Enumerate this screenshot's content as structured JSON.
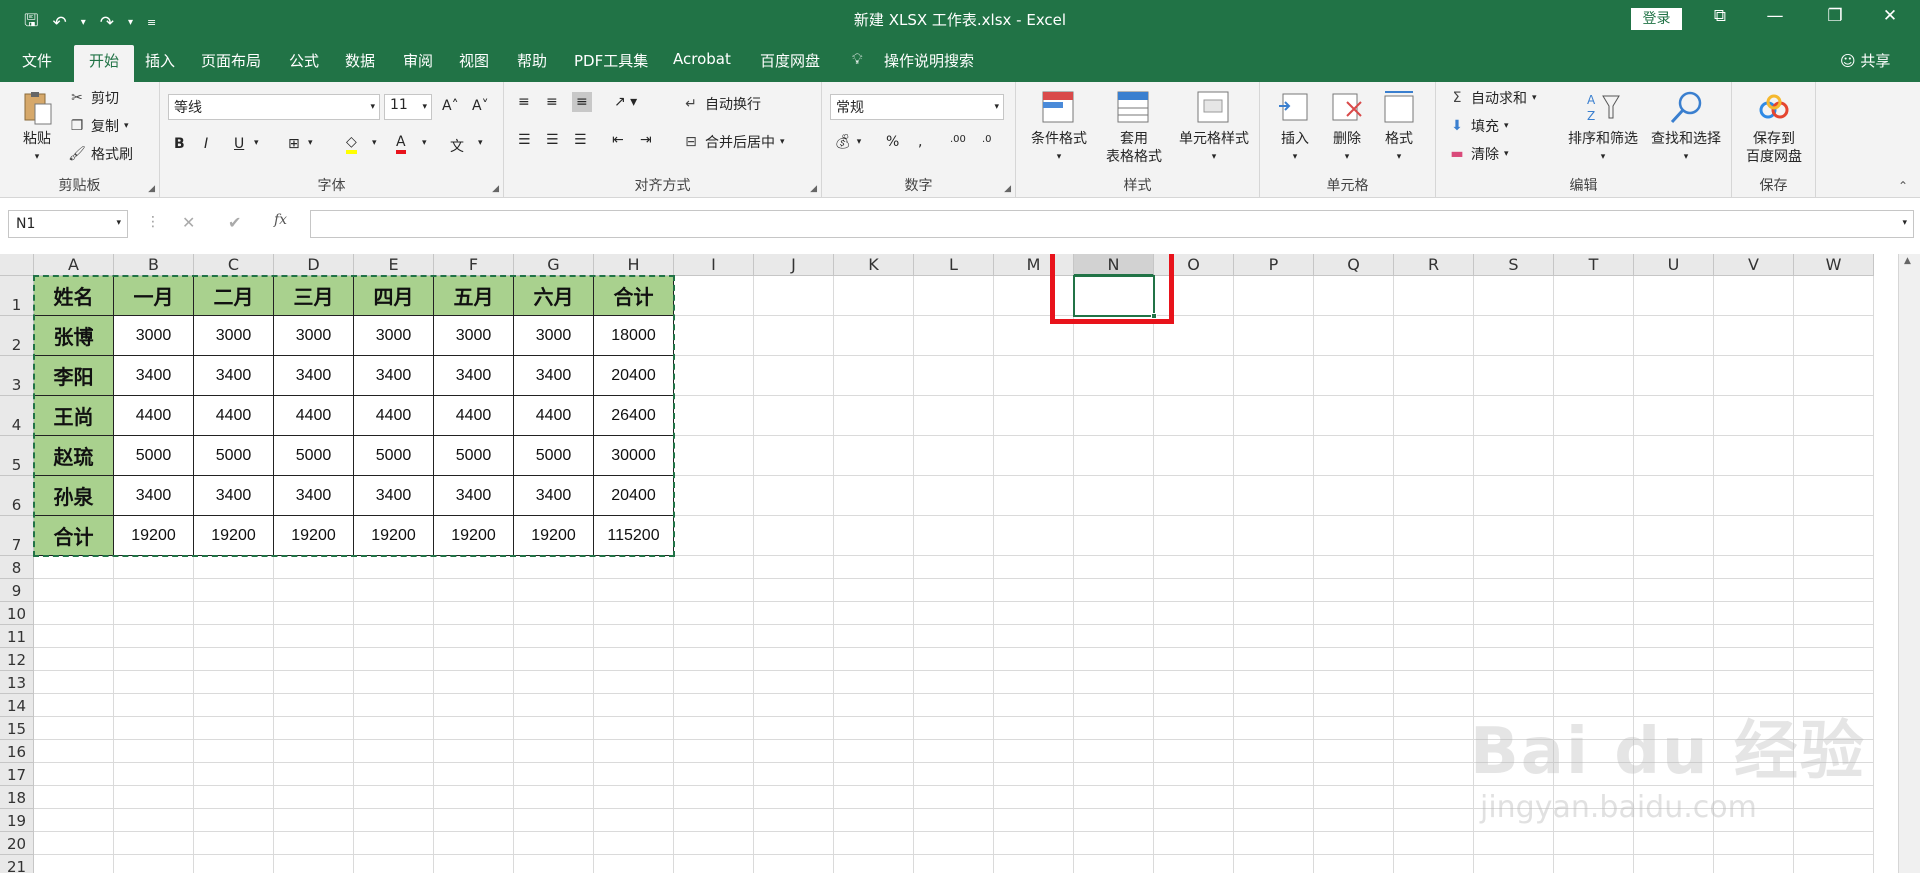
{
  "window": {
    "title": "新建 XLSX 工作表.xlsx  -  Excel",
    "login_label": "登录"
  },
  "tabs": [
    "文件",
    "开始",
    "插入",
    "页面布局",
    "公式",
    "数据",
    "审阅",
    "视图",
    "帮助",
    "PDF工具集",
    "Acrobat",
    "百度网盘"
  ],
  "active_tab": "开始",
  "search_label": "操作说明搜索",
  "share_label": "共享",
  "ribbon": {
    "clipboard": {
      "paste": "粘贴",
      "cut": "剪切",
      "copy": "复制",
      "format_painter": "格式刷",
      "group": "剪贴板"
    },
    "font": {
      "font_name": "等线",
      "font_size": "11",
      "bold": "B",
      "italic": "I",
      "underline": "U",
      "group": "字体"
    },
    "alignment": {
      "wrap": "自动换行",
      "merge": "合并后居中",
      "group": "对齐方式"
    },
    "number": {
      "format": "常规",
      "group": "数字"
    },
    "styles": {
      "conditional": "条件格式",
      "table_format_1": "套用",
      "table_format_2": "表格格式",
      "cell_styles": "单元格样式",
      "group": "样式"
    },
    "cells": {
      "insert": "插入",
      "delete": "删除",
      "format": "格式",
      "group": "单元格"
    },
    "editing": {
      "autosum": "自动求和",
      "fill": "填充",
      "clear": "清除",
      "sort": "排序和筛选",
      "find": "查找和选择",
      "group": "编辑"
    },
    "save": {
      "label_1": "保存到",
      "label_2": "百度网盘",
      "group": "保存"
    }
  },
  "formula_bar": {
    "name_box": "N1",
    "content": ""
  },
  "columns": [
    "A",
    "B",
    "C",
    "D",
    "E",
    "F",
    "G",
    "H",
    "I",
    "J",
    "K",
    "L",
    "M",
    "N",
    "O",
    "P",
    "Q",
    "R",
    "S",
    "T",
    "U",
    "V",
    "W"
  ],
  "rows": [
    "1",
    "2",
    "3",
    "4",
    "5",
    "6",
    "7",
    "8",
    "9",
    "10",
    "11",
    "12",
    "13",
    "14",
    "15",
    "16",
    "17",
    "18",
    "19",
    "20",
    "21"
  ],
  "table": {
    "header": [
      "姓名",
      "一月",
      "二月",
      "三月",
      "四月",
      "五月",
      "六月",
      "合计"
    ],
    "body": [
      [
        "张博",
        "3000",
        "3000",
        "3000",
        "3000",
        "3000",
        "3000",
        "18000"
      ],
      [
        "李阳",
        "3400",
        "3400",
        "3400",
        "3400",
        "3400",
        "3400",
        "20400"
      ],
      [
        "王尚",
        "4400",
        "4400",
        "4400",
        "4400",
        "4400",
        "4400",
        "26400"
      ],
      [
        "赵琉",
        "5000",
        "5000",
        "5000",
        "5000",
        "5000",
        "5000",
        "30000"
      ],
      [
        "孙泉",
        "3400",
        "3400",
        "3400",
        "3400",
        "3400",
        "3400",
        "20400"
      ],
      [
        "合计",
        "19200",
        "19200",
        "19200",
        "19200",
        "19200",
        "19200",
        "115200"
      ]
    ]
  },
  "colors": {
    "excel_green": "#217346",
    "header_fill": "#a9d18e",
    "highlight": "#e8131b"
  },
  "watermark": {
    "brand": "Bai du 经验",
    "url": "jingyan.baidu.com"
  }
}
